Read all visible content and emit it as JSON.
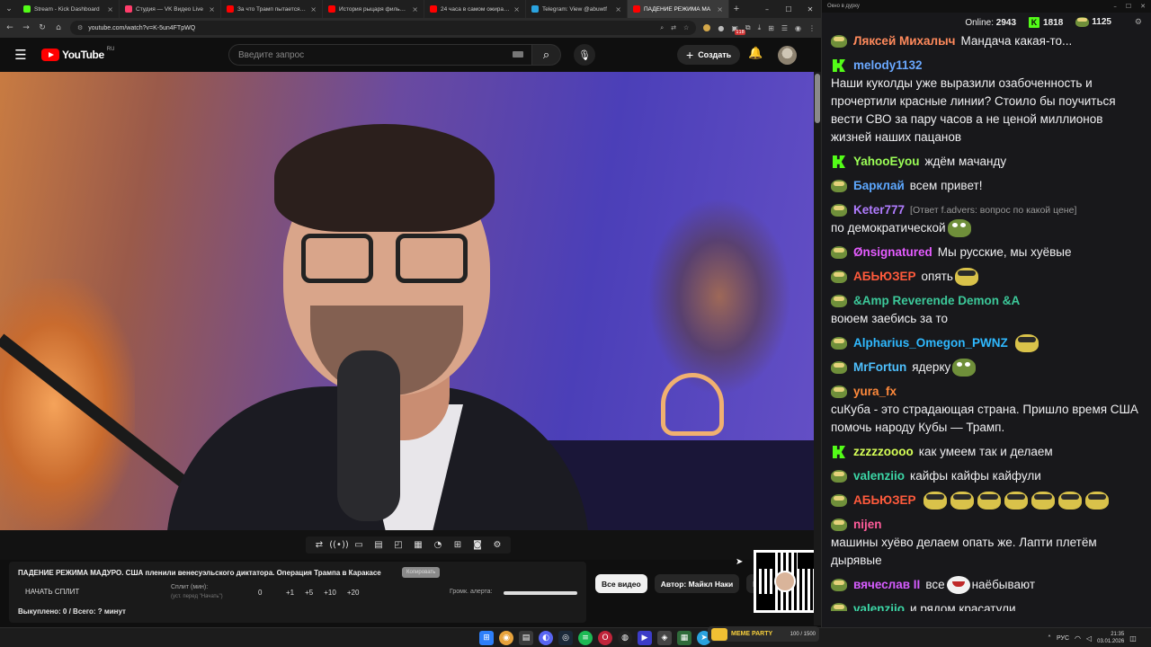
{
  "browser": {
    "tabs": [
      {
        "title": "Stream - Kick Dashboard",
        "color": "#53fc18",
        "active": false
      },
      {
        "title": "Студия — VK Видео Live",
        "color": "#ff3d6b",
        "active": false
      },
      {
        "title": "За что Трамп пытается убит",
        "color": "#ff0000",
        "active": false
      },
      {
        "title": "История рыцаря фильм, 20",
        "color": "#ff0000",
        "active": false
      },
      {
        "title": "24 часа в самом ожирающи",
        "color": "#ff0000",
        "active": false
      },
      {
        "title": "Telegram: View @abuwtf",
        "color": "#2aa3df",
        "active": false
      },
      {
        "title": "ПАДЕНИЕ РЕЖИМА МА",
        "color": "#ff0000",
        "active": true
      }
    ],
    "url": "youtube.com/watch?v=K-5un4FTpWQ",
    "ext_badge": "118"
  },
  "youtube": {
    "logo_text": "YouTube",
    "region": "RU",
    "search_placeholder": "Введите запрос",
    "create_label": "Создать"
  },
  "toolbar": {
    "icons": [
      "loop-icon",
      "broadcast-icon",
      "cast-icon",
      "clip-icon",
      "pip-icon",
      "chapters-icon",
      "speed-icon",
      "add-frame-icon",
      "screenshot-icon",
      "settings-icon"
    ]
  },
  "panel": {
    "title": "ПАДЕНИЕ РЕЖИМА МАДУРО. США пленили венесуэльского диктатора. Операция Трампа в Каракасе",
    "badge": "Копировать",
    "split_button": "НАЧАТЬ СПЛИТ",
    "split_label": "Сплит (мин):",
    "split_sub": "(уст. перед \"Начать\")",
    "split_value": "0",
    "increments": [
      "+1",
      "+5",
      "+10",
      "+20"
    ],
    "alert_label": "Громк. алерта:",
    "alert_volume": 1.0,
    "bought": "Выкуплено: 0 / Всего: ? минут"
  },
  "chips": [
    "Все видео",
    "Автор: Майкл Наки",
    "Н"
  ],
  "chat": {
    "window_title": "Окно в дурку",
    "online_label": "Online:",
    "online_value": "2943",
    "kick_count": "1818",
    "pepe_count": "1125",
    "messages": [
      {
        "badge": "pepe",
        "user": "Ляксей Михалыч",
        "color": "#ff8a5c",
        "reply": "",
        "text": "Мандача какая-то...",
        "emotes": []
      },
      {
        "badge": "kick",
        "user": "melody1132",
        "color": "#6aa8ff",
        "reply": "",
        "text": "Наши куколды уже выразили озабоченность и прочертили красные линии? Стоило бы поучиться вести СВО за пару часов а не ценой миллионов жизней наших пацанов",
        "emotes": []
      },
      {
        "badge": "kick",
        "user": "YahooEyou",
        "color": "#9cff57",
        "reply": "",
        "text": "ждём мачанду",
        "emotes": []
      },
      {
        "badge": "pepe",
        "user": "Барклай",
        "color": "#5da8ff",
        "reply": "",
        "text": "всем привет!",
        "emotes": []
      },
      {
        "badge": "pepe",
        "user": "Keter777",
        "color": "#b07cff",
        "reply": "[Ответ f.advers: вопрос по какой цене]",
        "text": "по демократической",
        "emotes": [
          "green"
        ]
      },
      {
        "badge": "pepe",
        "user": "Ønsignatured",
        "color": "#e45cff",
        "reply": "",
        "text": "Мы русские, мы хуёвые",
        "emotes": []
      },
      {
        "badge": "pepe",
        "user": "АБЬЮЗЕР",
        "color": "#ff5a3c",
        "reply": "",
        "text": "опять",
        "emotes": [
          "yellow"
        ]
      },
      {
        "badge": "pepe",
        "user": "&Amp Reverende Demon &A",
        "color": "#3cc99a",
        "reply": "",
        "text": "воюем заебись за то",
        "emotes": []
      },
      {
        "badge": "pepe",
        "user": "Alpharius_Omegon_PWNZ",
        "color": "#2fb9ff",
        "reply": "",
        "text": "",
        "emotes": [
          "yellow"
        ]
      },
      {
        "badge": "pepe",
        "user": "MrFortun",
        "color": "#4fc1ff",
        "reply": "",
        "text": "ядерку",
        "emotes": [
          "green"
        ]
      },
      {
        "badge": "pepe",
        "user": "yura_fx",
        "color": "#ff8a3c",
        "reply": "",
        "text": "cuКуба - это страдающая страна. Пришло время США помочь народу Кубы — Трамп.",
        "emotes": []
      },
      {
        "badge": "kick",
        "user": "zzzzzoooo",
        "color": "#d6ff57",
        "reply": "",
        "text": "как умеем так и делаем",
        "emotes": []
      },
      {
        "badge": "pepe",
        "user": "valenziio",
        "color": "#3cd6a6",
        "reply": "",
        "text": "кайфы кайфы кайфули",
        "emotes": []
      },
      {
        "badge": "pepe",
        "user": "АБЬЮЗЕР",
        "color": "#ff5a3c",
        "reply": "",
        "text": "",
        "emotes": [
          "yellow",
          "yellow",
          "yellow",
          "yellow",
          "yellow",
          "yellow",
          "yellow"
        ]
      },
      {
        "badge": "pepe",
        "user": "nijen",
        "color": "#ff5c9a",
        "reply": "",
        "text": "машины хуёво делаем опать же. Лапти плетём дырявые",
        "emotes": []
      },
      {
        "badge": "pepe",
        "user": "вячеслав II",
        "color": "#d65cff",
        "reply": "",
        "text": "все",
        "emotes": [
          "face"
        ],
        "text_after": "наёбывают"
      },
      {
        "badge": "pepe",
        "user": "valenziio",
        "color": "#3cd6a6",
        "reply": "",
        "text": "и рядом красатули",
        "emotes": []
      }
    ]
  },
  "taskbar": {
    "meme_label": "MEME PARTY",
    "meme_count": "100 / 1500",
    "lang": "РУС",
    "time": "21:35",
    "date": "03.01.2026"
  }
}
